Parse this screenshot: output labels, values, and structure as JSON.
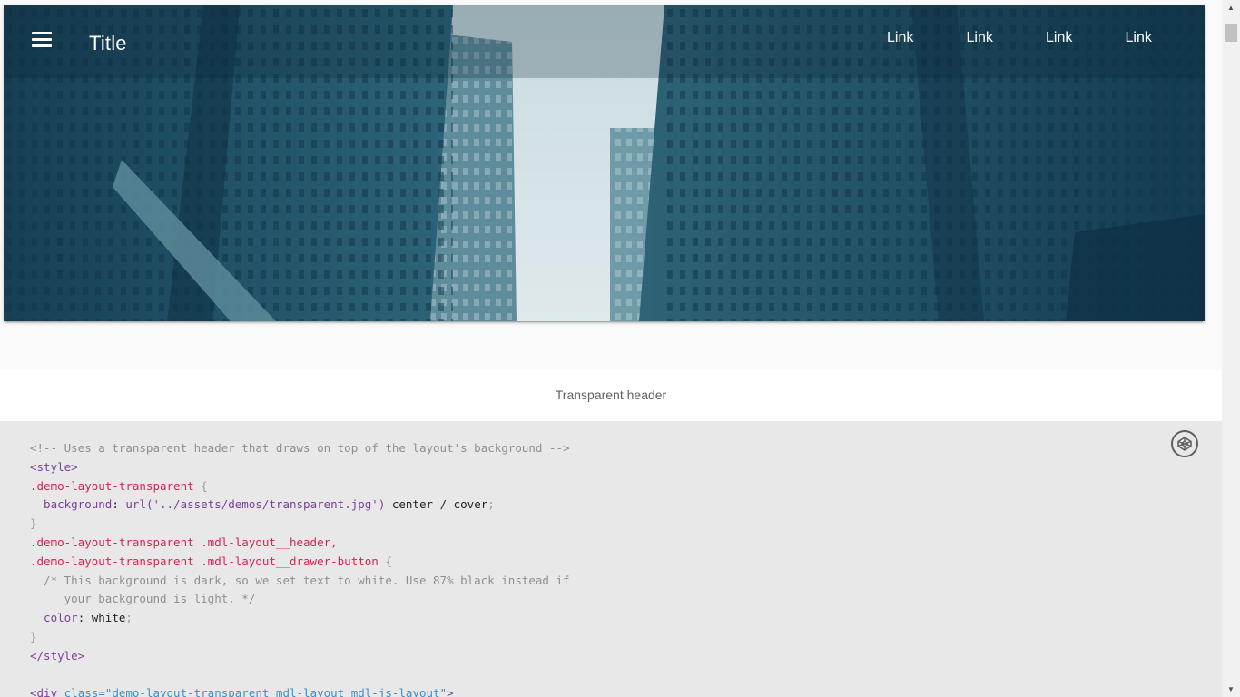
{
  "header": {
    "title": "Title",
    "nav_links": [
      "Link",
      "Link",
      "Link",
      "Link"
    ]
  },
  "caption": {
    "text": "Transparent header"
  },
  "code": {
    "lines": [
      [
        {
          "t": "comment",
          "v": "<!-- Uses a transparent header that draws on top of the layout's background -->"
        }
      ],
      [
        {
          "t": "tag",
          "v": "<style>"
        }
      ],
      [
        {
          "t": "selector",
          "v": ".demo-layout-transparent"
        },
        {
          "t": "punct",
          "v": " {"
        }
      ],
      [
        {
          "t": "prop",
          "v": "  background"
        },
        {
          "t": "plain",
          "v": ": "
        },
        {
          "t": "string",
          "v": "url('../assets/demos/transparent.jpg')"
        },
        {
          "t": "plain",
          "v": " center / cover"
        },
        {
          "t": "punct",
          "v": ";"
        }
      ],
      [
        {
          "t": "punct",
          "v": "}"
        }
      ],
      [
        {
          "t": "selector",
          "v": ".demo-layout-transparent .mdl-layout__header,"
        }
      ],
      [
        {
          "t": "selector",
          "v": ".demo-layout-transparent .mdl-layout__drawer-button"
        },
        {
          "t": "punct",
          "v": " {"
        }
      ],
      [
        {
          "t": "comment",
          "v": "  /* This background is dark, so we set text to white. Use 87% black instead if"
        }
      ],
      [
        {
          "t": "comment",
          "v": "     your background is light. */"
        }
      ],
      [
        {
          "t": "prop",
          "v": "  color"
        },
        {
          "t": "plain",
          "v": ": white"
        },
        {
          "t": "punct",
          "v": ";"
        }
      ],
      [
        {
          "t": "punct",
          "v": "}"
        }
      ],
      [
        {
          "t": "tag",
          "v": "</style>"
        }
      ],
      [
        {
          "t": "plain",
          "v": ""
        }
      ],
      [
        {
          "t": "tag",
          "v": "<div "
        },
        {
          "t": "attr",
          "v": "class=\"demo-layout-transparent mdl-layout mdl-js-layout\""
        },
        {
          "t": "tag",
          "v": ">"
        }
      ]
    ]
  },
  "icons": {
    "menu": "hamburger-menu-icon",
    "codepen": "codepen-icon",
    "scroll_up": "scroll-up-arrow-icon",
    "scroll_down": "scroll-down-arrow-icon"
  },
  "colors": {
    "header_text": "#ffffff",
    "caption_bg": "#ffffff",
    "code_bg": "#e8e8e8",
    "selector": "#d1254f",
    "keyword": "#7b3f9c",
    "comment": "#8f8f8f"
  }
}
